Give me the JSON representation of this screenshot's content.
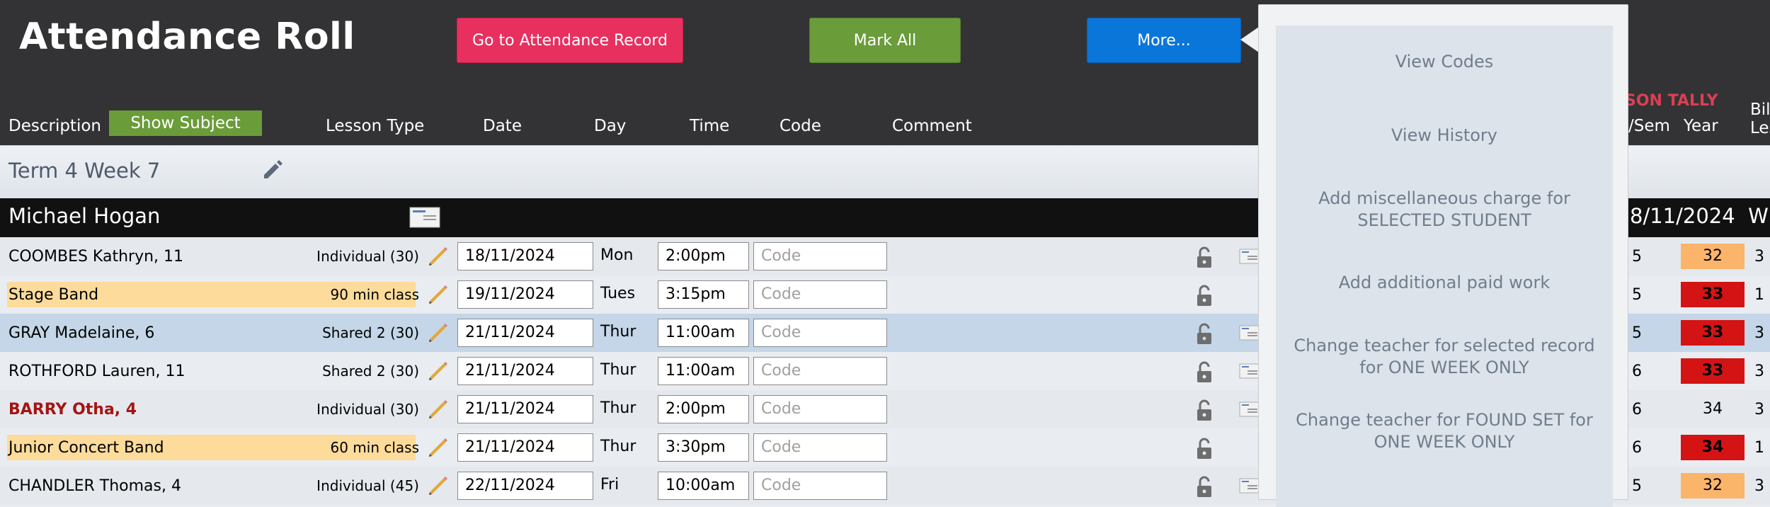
{
  "header": {
    "title": "Attendance Roll",
    "goto_label": "Go to Attendance Record",
    "markall_label": "Mark All",
    "more_label": "More..."
  },
  "columns": {
    "description": "Description",
    "show_subject": "Show Subject",
    "lesson_type": "Lesson Type",
    "date": "Date",
    "day": "Day",
    "time": "Time",
    "code": "Code",
    "comment": "Comment",
    "tally_title": "SON TALLY",
    "tally_term": "/Sem",
    "tally_year": "Year",
    "billed_1": "Bill",
    "billed_2": "Les"
  },
  "term": {
    "label": "Term 4 Week 7"
  },
  "teacher": {
    "name": "Michael Hogan",
    "date": "8/11/2024",
    "date_suffix": "W"
  },
  "code_placeholder": "Code",
  "rows": [
    {
      "name": "COOMBES Kathryn, 11",
      "lesson": "Individual (30)",
      "date": "18/11/2024",
      "day": "Mon",
      "time": "2:00pm",
      "t1": "5",
      "t2": "32",
      "t3": "3"
    },
    {
      "name": "Stage Band",
      "lesson": "90 min class",
      "date": "19/11/2024",
      "day": "Tues",
      "time": "3:15pm",
      "t1": "5",
      "t2": "33",
      "t3": "1"
    },
    {
      "name": "GRAY Madelaine, 6",
      "lesson": "Shared 2 (30)",
      "date": "21/11/2024",
      "day": "Thur",
      "time": "11:00am",
      "t1": "5",
      "t2": "33",
      "t3": "3"
    },
    {
      "name": "ROTHFORD Lauren, 11",
      "lesson": "Shared 2 (30)",
      "date": "21/11/2024",
      "day": "Thur",
      "time": "11:00am",
      "t1": "6",
      "t2": "33",
      "t3": "3"
    },
    {
      "name": "BARRY Otha, 4",
      "lesson": "Individual (30)",
      "date": "21/11/2024",
      "day": "Thur",
      "time": "2:00pm",
      "t1": "6",
      "t2": "34",
      "t3": "3"
    },
    {
      "name": "Junior Concert Band",
      "lesson": "60 min class",
      "date": "21/11/2024",
      "day": "Thur",
      "time": "3:30pm",
      "t1": "6",
      "t2": "34",
      "t3": "1"
    },
    {
      "name": "CHANDLER Thomas, 4",
      "lesson": "Individual (45)",
      "date": "22/11/2024",
      "day": "Fri",
      "time": "10:00am",
      "t1": "5",
      "t2": "32",
      "t3": "3"
    }
  ],
  "menu": {
    "view_codes": "View Codes",
    "view_history": "View History",
    "misc_charge_1": "Add miscellaneous charge for",
    "misc_charge_2": "SELECTED STUDENT",
    "paid_work": "Add additional paid work",
    "change_selected_1": "Change teacher for selected record",
    "change_selected_2": "for ONE WEEK ONLY",
    "change_found_1": "Change teacher for FOUND SET for",
    "change_found_2": "ONE WEEK ONLY"
  },
  "colors": {
    "goto": "#e8305f",
    "markall": "#6a9c3a",
    "more": "#0b76d9",
    "subject_row": "#fddb9a",
    "tally_orange": "#fbb56a",
    "tally_red": "#d41414",
    "tally_title": "#d94054"
  }
}
